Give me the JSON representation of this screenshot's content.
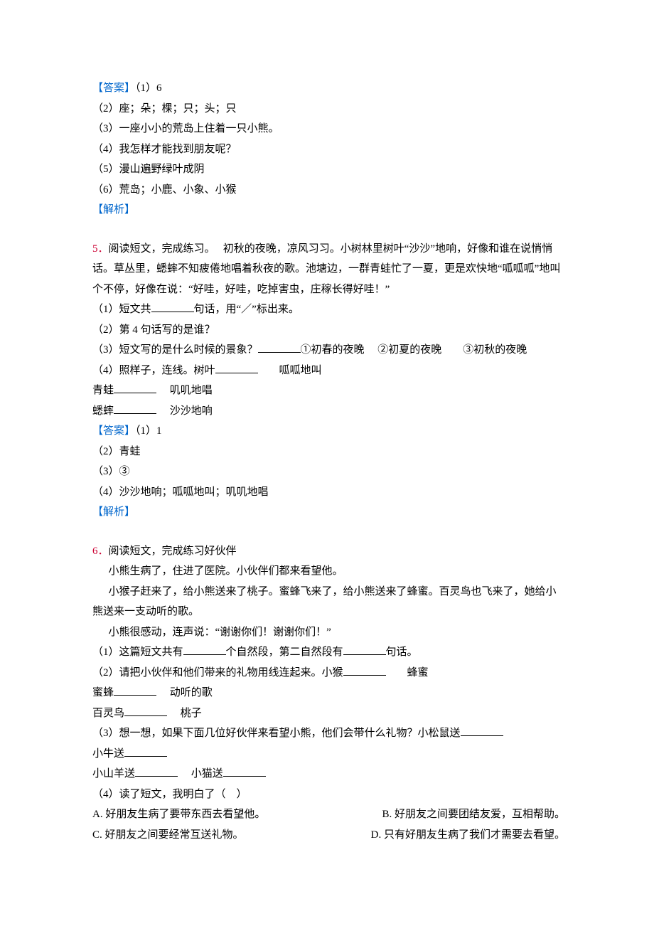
{
  "q4": {
    "ans_label": "【答案】",
    "a1": "（1）6",
    "a2": "（2）座；朵；棵；只；头；只",
    "a3": "（3）一座小小的荒岛上住着一只小熊。",
    "a4": "（4）我怎样才能找到朋友呢？",
    "a5": "（5）漫山遍野绿叶成阴",
    "a6": "（6）荒岛；小鹿、小象、小猴",
    "analysis_label": "【解析】"
  },
  "q5": {
    "num": "5．",
    "stem1": "阅读短文，完成练习。　 初秋的夜晚，凉风习习。小树林里树叶“沙沙”地响，好像和谁在说悄悄话。草丛里，蟋蟀不知疲倦地唱着秋夜的歌。池塘边，一群青蛙忙了一夏，更是欢快地“呱呱呱”地叫个不停，好像在说：“好哇，好哇，吃掉害虫，庄稼长得好哇！”",
    "p1a": "（1）短文共",
    "p1b": "句话，用“／”标出来。",
    "p2": "（2）第 4 句话写的是谁？",
    "p3a": "（3）短文写的是什么时候的景象？",
    "p3b": "①初春的夜晚　 ②初夏的夜晚　　③初秋的夜晚",
    "p4a": "（4）照样子，连线。树叶",
    "p4b": "　　呱呱地叫",
    "p4c": "青蛙",
    "p4d": "　 叽叽地唱",
    "p4e": "蟋蟀",
    "p4f": "　 沙沙地响",
    "ans_label": "【答案】",
    "a1": "（1）1",
    "a2": "（2）青蛙",
    "a3": "（3）③",
    "a4": "（4）沙沙地响；呱呱地叫；叽叽地唱",
    "analysis_label": "【解析】"
  },
  "q6": {
    "num": "6．",
    "stem_head": "阅读短文，完成练习好伙伴",
    "para1": "小熊生病了，住进了医院。小伙伴们都来看望他。",
    "para2": "小猴子赶来了，给小熊送来了桃子。蜜蜂飞来了，给小熊送来了蜂蜜。百灵鸟也飞来了，她给小熊送来一支动听的歌。",
    "para3": "小熊很感动，连声说：“谢谢你们！谢谢你们！”",
    "p1a": "（1）这篇短文共有",
    "p1b": "个自然段，第二自然段有",
    "p1c": "句话。",
    "p2a": "（2）请把小伙伴和他们带来的礼物用线连起来。小猴",
    "p2b": "　　蜂蜜",
    "p2c": "蜜蜂",
    "p2d": "　 动听的歌",
    "p2e": "百灵鸟",
    "p2f": "　 桃子",
    "p3a": "（3）想一想，如果下面几位好伙伴来看望小熊，他们会带什么礼物？小松鼠送",
    "p3b": "小牛送",
    "p3c": "小山羊送",
    "p3d": "　 小猫送",
    "p4": "（4）读了短文，我明白了（　）",
    "optA": "A. 好朋友生病了要带东西去看望他。",
    "optB": "B. 好朋友之间要团结友爱，互相帮助。",
    "optC": "C. 好朋友之间要经常互送礼物。",
    "optD": "D. 只有好朋友生病了我们才需要去看望。"
  }
}
